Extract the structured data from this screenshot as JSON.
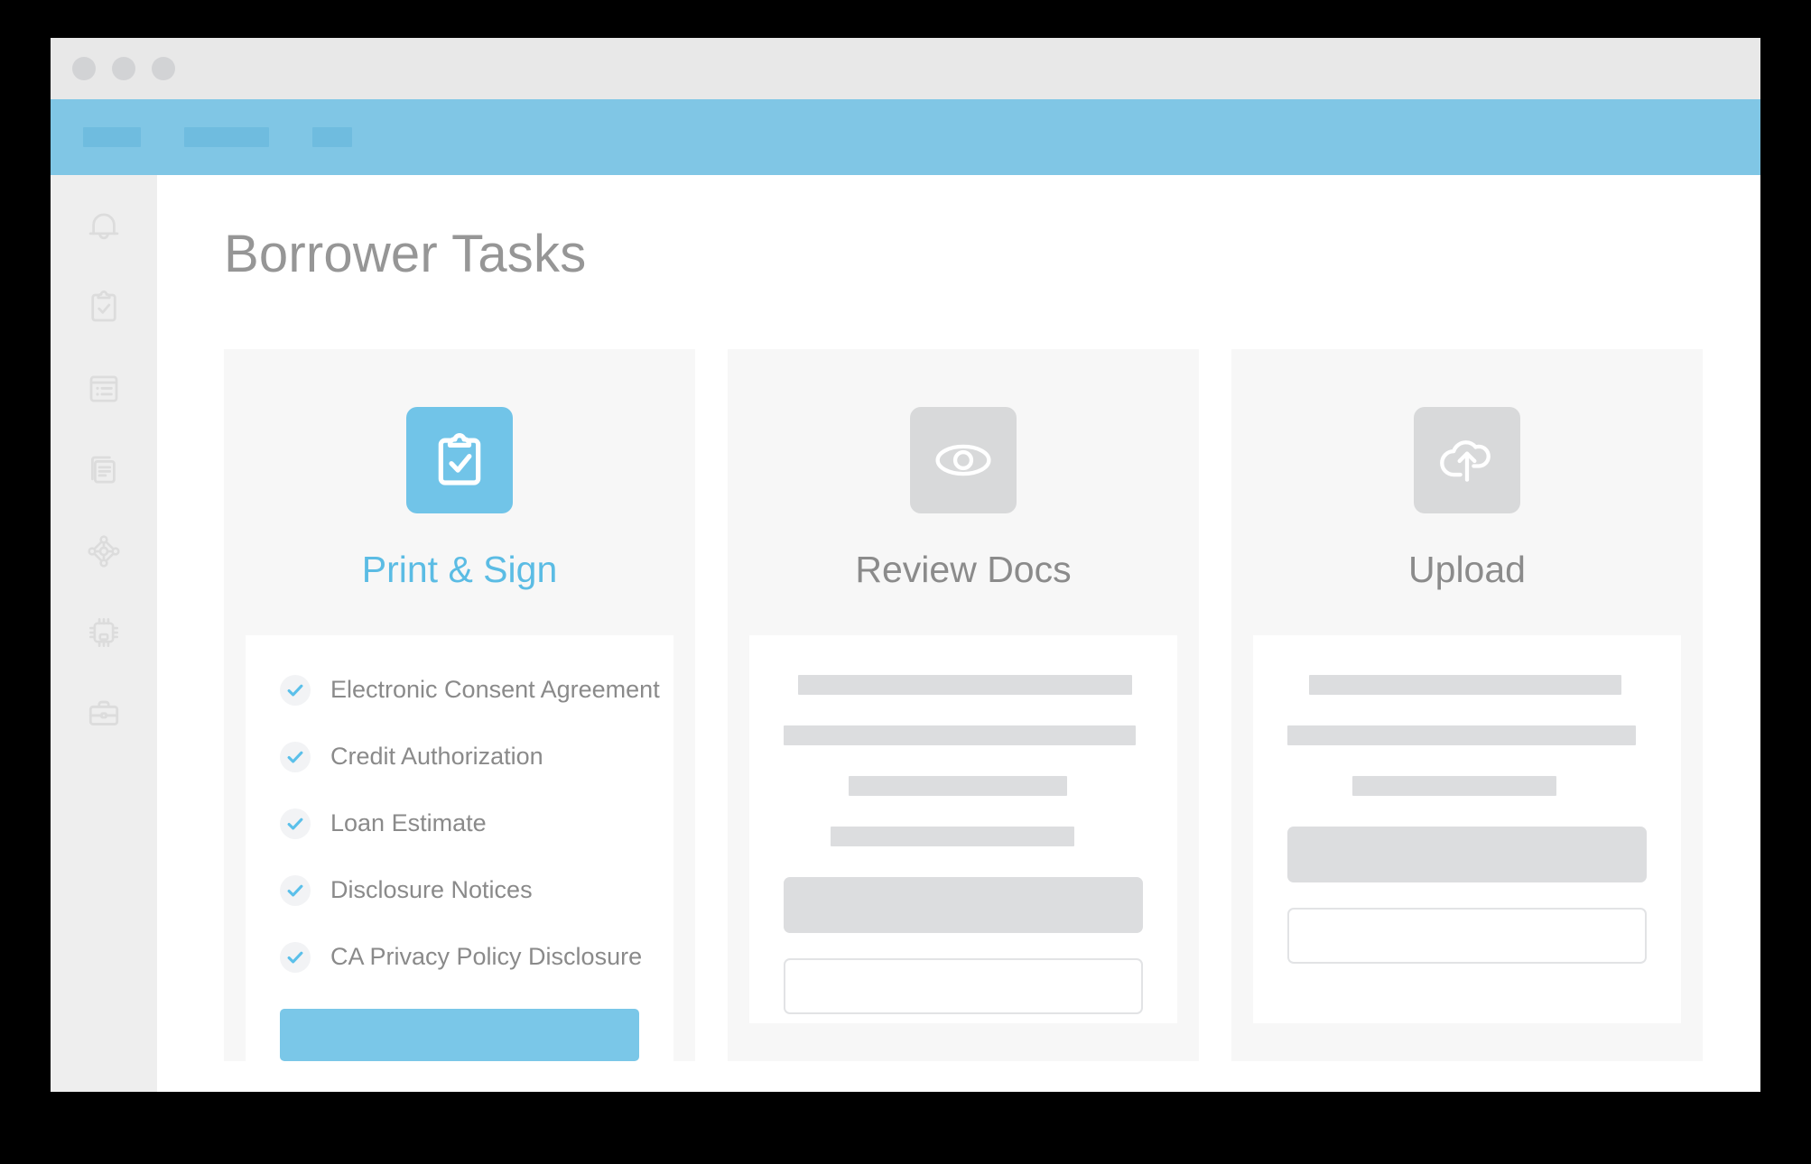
{
  "window": {
    "titlebar": {
      "dots": [
        "close-dot",
        "minimize-dot",
        "maximize-dot"
      ]
    },
    "app_header": {
      "nav_placeholders": [
        "nav-placeholder-1",
        "nav-placeholder-2",
        "nav-placeholder-3"
      ],
      "background_color": "#80c6e5",
      "placeholder_color": "#6fbcdf"
    }
  },
  "sidebar": {
    "background_color": "#eeeeee",
    "icon_color": "#dcdcdc",
    "items": [
      {
        "icon": "bell-icon",
        "label": "Notifications"
      },
      {
        "icon": "clipboard-check-icon",
        "label": "Tasks"
      },
      {
        "icon": "list-icon",
        "label": "Checklist"
      },
      {
        "icon": "documents-icon",
        "label": "Documents"
      },
      {
        "icon": "network-nodes-icon",
        "label": "Connections"
      },
      {
        "icon": "chip-icon",
        "label": "Processing"
      },
      {
        "icon": "briefcase-icon",
        "label": "Portfolio"
      }
    ]
  },
  "main": {
    "page_title": "Borrower Tasks",
    "title_color": "#969696",
    "cards": [
      {
        "id": "print-and-sign",
        "label": "Print & Sign",
        "icon": "clipboard-check-icon",
        "tile_color": "#71c4e8",
        "label_color": "#5bbce4",
        "active": true,
        "checklist": [
          "Electronic Consent Agreement",
          "Credit Authorization",
          "Loan Estimate",
          "Disclosure Notices",
          "CA Privacy Policy Disclosure"
        ],
        "cta_label": "",
        "cta_color": "#7ac7e8"
      },
      {
        "id": "review-docs",
        "label": "Review Docs",
        "icon": "eye-icon",
        "tile_color": "#d8d9da",
        "label_color": "#8b8b8b",
        "active": false,
        "skeleton_lines": [
          {
            "width": "93%",
            "offset": "4%"
          },
          {
            "width": "98%",
            "offset": "0%"
          },
          {
            "width": "61%",
            "offset": "18%"
          },
          {
            "width": "68%",
            "offset": "13%"
          }
        ],
        "buttons": [
          "filled-placeholder-button",
          "outlined-placeholder-button"
        ]
      },
      {
        "id": "upload",
        "label": "Upload",
        "icon": "cloud-upload-icon",
        "tile_color": "#d8d9da",
        "label_color": "#8b8b8b",
        "active": false,
        "skeleton_lines": [
          {
            "width": "87%",
            "offset": "6%"
          },
          {
            "width": "97%",
            "offset": "0%"
          },
          {
            "width": "57%",
            "offset": "18%"
          }
        ],
        "buttons": [
          "filled-placeholder-button",
          "outlined-placeholder-button"
        ]
      }
    ]
  },
  "colors": {
    "accent_blue": "#71c4e8",
    "header_blue": "#80c6e5",
    "card_background": "#f7f7f7",
    "skeleton_gray": "#dcdddf",
    "text_gray": "#8a8a8a"
  }
}
